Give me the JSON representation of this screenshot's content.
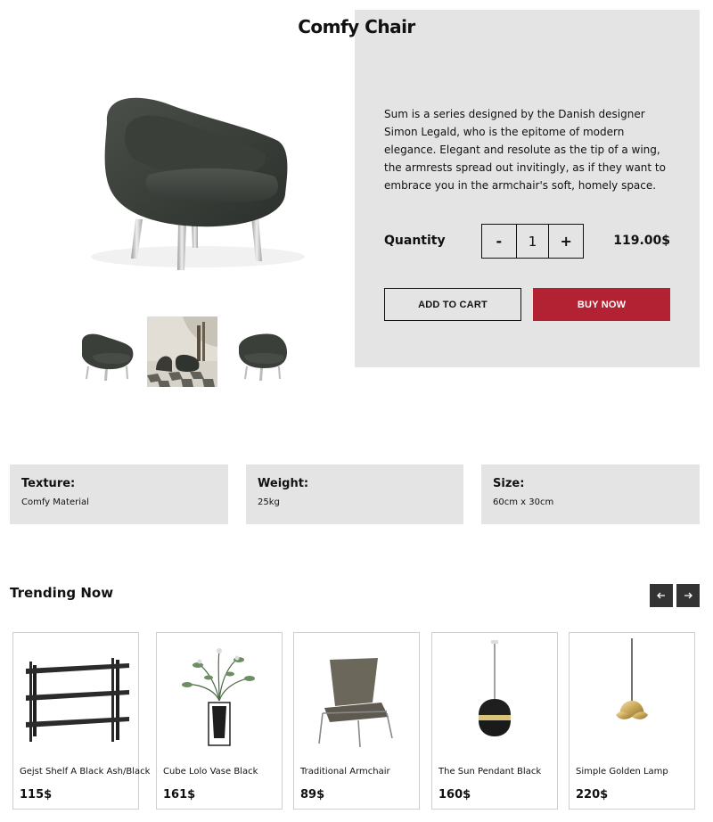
{
  "product": {
    "title": "Comfy Chair",
    "description": "Sum is a series designed by the Danish designer Simon Legald, who is the epitome of modern elegance. Elegant and resolute as the tip of a wing, the armrests spread out invitingly, as if they want to embrace you in the armchair's soft, homely space.",
    "quantity_label": "Quantity",
    "quantity_value": "1",
    "decrement_label": "-",
    "increment_label": "+",
    "price": "119.00$",
    "add_to_cart_label": "ADD TO CART",
    "buy_now_label": "BUY NOW",
    "thumbnails": [
      "chair-front-thumb",
      "chair-lifestyle-thumb",
      "chair-side-thumb"
    ]
  },
  "specs": [
    {
      "key": "Texture:",
      "value": "Comfy Material"
    },
    {
      "key": "Weight:",
      "value": "25kg"
    },
    {
      "key": "Size:",
      "value": "60cm x 30cm"
    }
  ],
  "trending": {
    "title": "Trending Now",
    "prev_icon": "arrow-left-icon",
    "next_icon": "arrow-right-icon",
    "items": [
      {
        "name": "Gejst Shelf A Black Ash/Black",
        "price": "115$"
      },
      {
        "name": "Cube Lolo Vase Black",
        "price": "161$"
      },
      {
        "name": "Traditional Armchair",
        "price": "89$"
      },
      {
        "name": "The Sun Pendant Black",
        "price": "160$"
      },
      {
        "name": "Simple Golden Lamp",
        "price": "220$"
      }
    ]
  },
  "colors": {
    "panel_bg": "#e4e4e4",
    "buy_button": "#b22232",
    "nav_button": "#333333"
  }
}
